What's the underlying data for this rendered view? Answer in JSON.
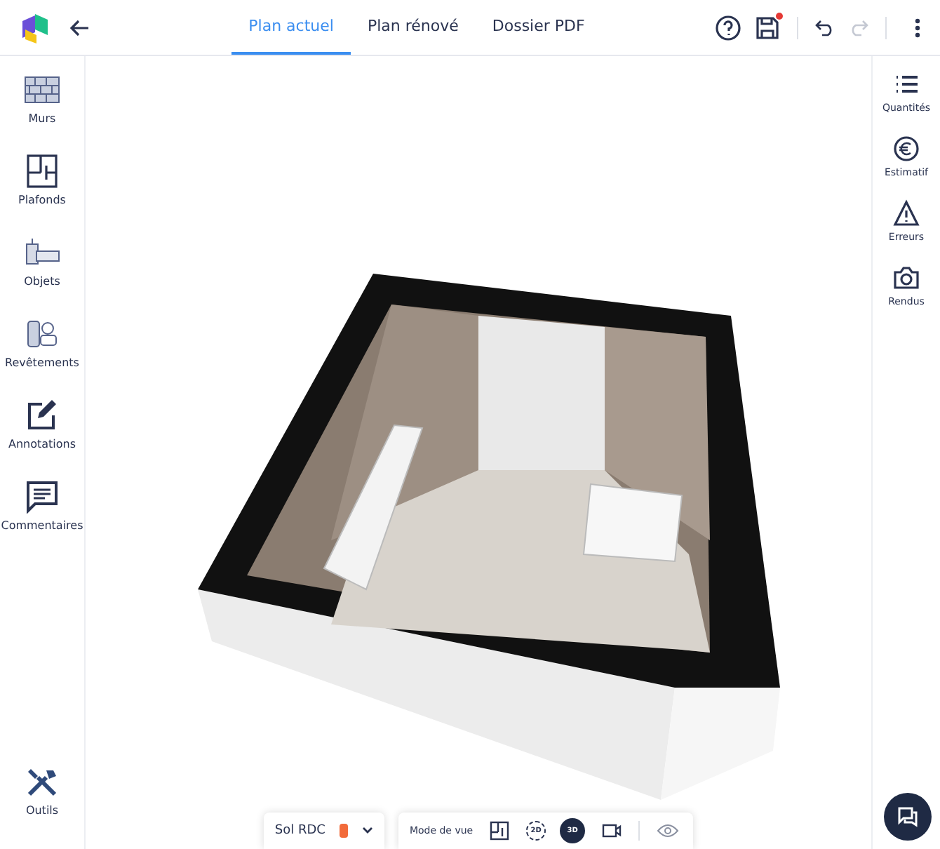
{
  "header": {
    "tabs": [
      {
        "label": "Plan actuel",
        "selected": true
      },
      {
        "label": "Plan rénové",
        "selected": false
      },
      {
        "label": "Dossier PDF",
        "selected": false
      }
    ],
    "unsaved": true
  },
  "left_sidebar": {
    "items": [
      {
        "label": "Murs",
        "kind": "walls"
      },
      {
        "label": "Plafonds",
        "kind": "ceilings"
      },
      {
        "label": "Objets",
        "kind": "objects"
      },
      {
        "label": "Revêtements",
        "kind": "coverings"
      },
      {
        "label": "Annotations",
        "kind": "annotations"
      },
      {
        "label": "Commentaires",
        "kind": "comments"
      }
    ],
    "bottom_item": {
      "label": "Outils"
    }
  },
  "right_sidebar": {
    "items": [
      {
        "label": "Quantités",
        "kind": "list"
      },
      {
        "label": "Estimatif",
        "kind": "euro"
      },
      {
        "label": "Erreurs",
        "kind": "warning"
      },
      {
        "label": "Rendus",
        "kind": "camera"
      }
    ]
  },
  "floor_selector": {
    "label": "Sol RDC",
    "color": "#f26b3a"
  },
  "view_toolbar": {
    "label": "Mode de vue",
    "modes": [
      {
        "kind": "plan",
        "selected": false
      },
      {
        "kind": "flat",
        "label": "2D",
        "selected": false
      },
      {
        "kind": "perspective",
        "label": "3D",
        "selected": true
      },
      {
        "kind": "video",
        "selected": false
      }
    ]
  }
}
